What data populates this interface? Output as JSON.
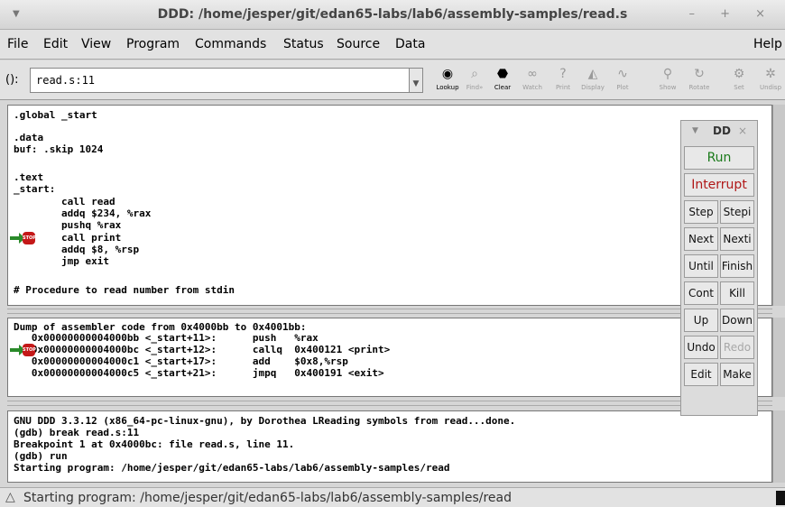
{
  "window": {
    "title": "DDD: /home/jesper/git/edan65-labs/lab6/assembly-samples/read.s",
    "controls": "– + ×"
  },
  "menu": {
    "file": "File",
    "edit": "Edit",
    "view": "View",
    "program": "Program",
    "commands": "Commands",
    "status": "Status",
    "source": "Source",
    "data": "Data",
    "help": "Help"
  },
  "argfield": {
    "label": "():",
    "value": "read.s:11"
  },
  "toolbar": {
    "lookup": "Lookup",
    "find": "Find»",
    "clear": "Clear",
    "watch": "Watch",
    "print": "Print",
    "display": "Display",
    "plot": "Plot",
    "show": "Show",
    "rotate": "Rotate",
    "set": "Set",
    "undisp": "Undisp"
  },
  "source_lines": [
    ".global _start",
    "",
    ".data",
    "buf: .skip 1024",
    "",
    ".text",
    "_start:",
    "        call read",
    "        addq $234, %rax",
    "        pushq %rax",
    "        call print",
    "        addq $8, %rsp",
    "        jmp exit",
    "",
    "# Procedure to read number from stdin"
  ],
  "machine_lines": [
    "Dump of assembler code from 0x4000bb to 0x4001bb:",
    "   0x00000000004000bb <_start+11>:      push   %rax",
    "   0x00000000004000bc <_start+12>:      callq  0x400121 <print>",
    "   0x00000000004000c1 <_start+17>:      add    $0x8,%rsp",
    "   0x00000000004000c5 <_start+21>:      jmpq   0x400191 <exit>"
  ],
  "console_lines": [
    "GNU DDD 3.3.12 (x86_64-pc-linux-gnu), by Dorothea LReading symbols from read...done.",
    "(gdb) break read.s:11",
    "Breakpoint 1 at 0x4000bc: file read.s, line 11.",
    "(gdb) run",
    "Starting program: /home/jesper/git/edan65-labs/lab6/assembly-samples/read"
  ],
  "status": "Starting program: /home/jesper/git/edan65-labs/lab6/assembly-samples/read",
  "stop_label": "STOP",
  "panel": {
    "title": "DD",
    "run": "Run",
    "interrupt": "Interrupt",
    "step": "Step",
    "stepi": "Stepi",
    "next": "Next",
    "nexti": "Nexti",
    "until": "Until",
    "finish": "Finish",
    "cont": "Cont",
    "kill": "Kill",
    "up": "Up",
    "down": "Down",
    "undo": "Undo",
    "redo": "Redo",
    "edit": "Edit",
    "make": "Make"
  },
  "colors": {
    "run": "#1a7a1a",
    "interrupt": "#b01818",
    "stop": "#c41818",
    "arrow": "#2a8a2a"
  }
}
